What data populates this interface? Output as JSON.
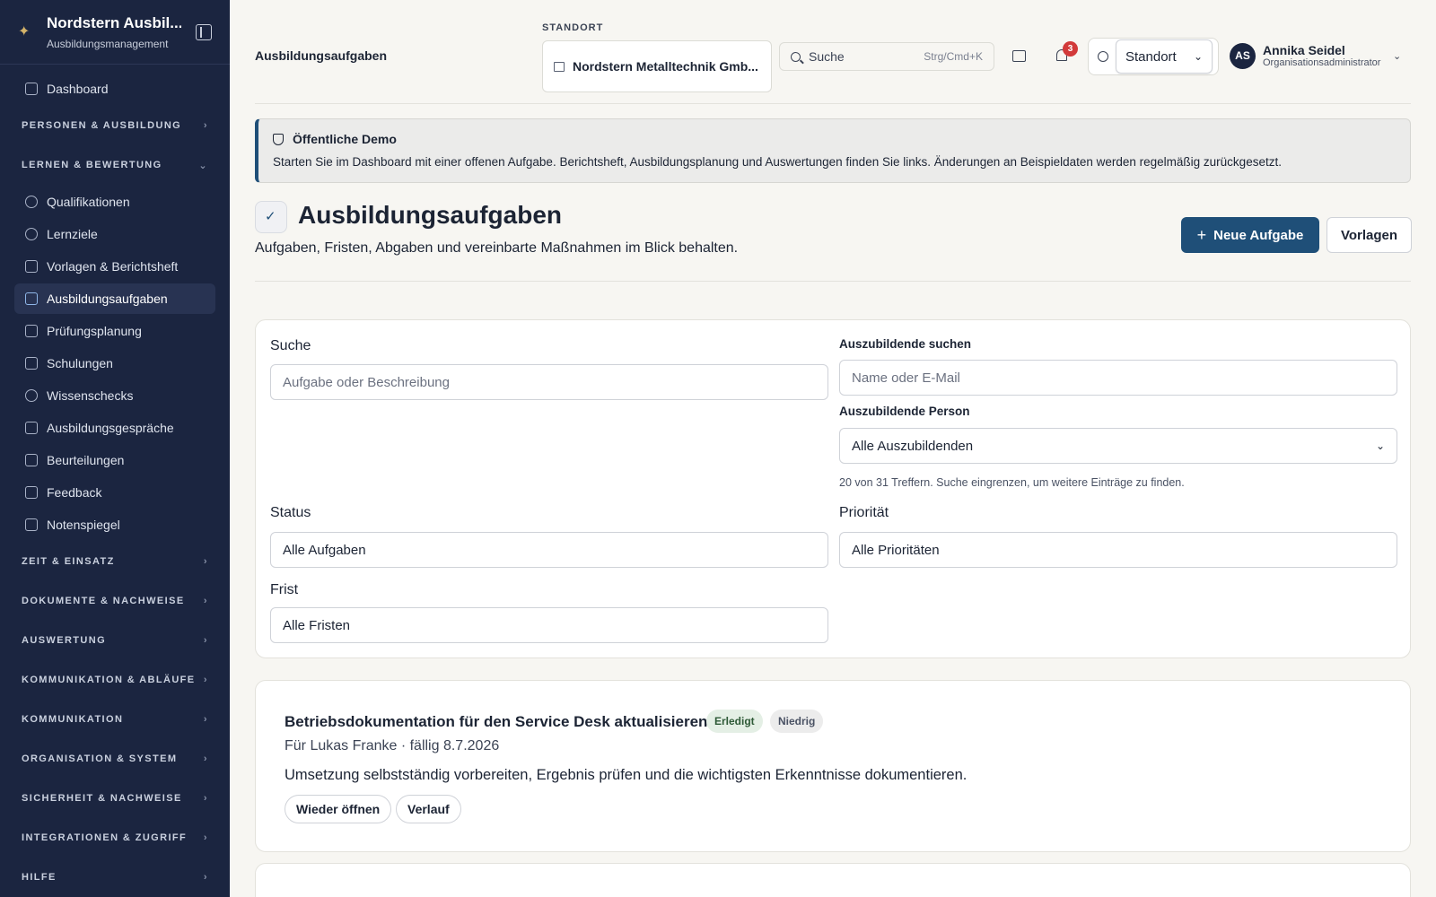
{
  "brand": {
    "title": "Nordstern Ausbil...",
    "subtitle": "Ausbildungsmanagement"
  },
  "sidebar": {
    "top_item": "Dashboard",
    "groups_before": [
      {
        "label": "PERSONEN & AUSBILDUNG"
      },
      {
        "label": "LERNEN & BEWERTUNG"
      }
    ],
    "items": [
      {
        "label": "Qualifikationen",
        "icon": "award-icon"
      },
      {
        "label": "Lernziele",
        "icon": "target-icon"
      },
      {
        "label": "Vorlagen & Berichtsheft",
        "icon": "file-icon"
      },
      {
        "label": "Ausbildungsaufgaben",
        "icon": "checkbox-icon",
        "active": true
      },
      {
        "label": "Prüfungsplanung",
        "icon": "calendar-icon"
      },
      {
        "label": "Schulungen",
        "icon": "book-icon"
      },
      {
        "label": "Wissenschecks",
        "icon": "brain-icon"
      },
      {
        "label": "Ausbildungsgespräche",
        "icon": "message-icon"
      },
      {
        "label": "Beurteilungen",
        "icon": "bar-chart-icon"
      },
      {
        "label": "Feedback",
        "icon": "chat-icon"
      },
      {
        "label": "Notenspiegel",
        "icon": "file-icon"
      }
    ],
    "groups_after": [
      "ZEIT & EINSATZ",
      "DOKUMENTE & NACHWEISE",
      "AUSWERTUNG",
      "KOMMUNIKATION & ABLÄUFE",
      "KOMMUNIKATION",
      "ORGANISATION & SYSTEM",
      "SICHERHEIT & NACHWEISE",
      "INTEGRATIONEN & ZUGRIFF",
      "HILFE"
    ]
  },
  "topbar": {
    "breadcrumb": "Ausbildungsaufgaben",
    "location_label": "STANDORT",
    "location_value": "Nordstern Metalltechnik Gmb...",
    "search_placeholder": "Suche",
    "search_shortcut": "Strg/Cmd+K",
    "notification_count": "3",
    "site_select": "Standort",
    "user_initials": "AS",
    "user_name": "Annika Seidel",
    "user_role": "Organisationsadministrator"
  },
  "demo": {
    "title": "Öffentliche Demo",
    "text": "Starten Sie im Dashboard mit einer offenen Aufgabe. Berichtsheft, Ausbildungsplanung und Auswertungen finden Sie links. Änderungen an Beispieldaten werden regelmäßig zurückgesetzt."
  },
  "page": {
    "title": "Ausbildungsaufgaben",
    "description": "Aufgaben, Fristen, Abgaben und vereinbarte Maßnahmen im Blick behalten.",
    "new_button": "Neue Aufgabe",
    "templates_button": "Vorlagen"
  },
  "filters": {
    "search_label": "Suche",
    "search_placeholder": "Aufgabe oder Beschreibung",
    "trainee_search_label": "Auszubildende suchen",
    "trainee_search_placeholder": "Name oder E-Mail",
    "trainee_label": "Auszubildende Person",
    "trainee_value": "Alle Auszubildenden",
    "hint": "20 von 31 Treffern. Suche eingrenzen, um weitere Einträge zu finden.",
    "status_label": "Status",
    "status_value": "Alle Aufgaben",
    "priority_label": "Priorität",
    "priority_value": "Alle Prioritäten",
    "deadline_label": "Frist",
    "deadline_value": "Alle Fristen"
  },
  "task": {
    "title": "Betriebsdokumentation für den Service Desk aktualisieren",
    "status": "Erledigt",
    "priority": "Niedrig",
    "meta": "Für Lukas Franke · fällig 8.7.2026",
    "description": "Umsetzung selbstständig vorbereiten, Ergebnis prüfen und die wichtigsten Erkenntnisse dokumentieren.",
    "reopen": "Wieder öffnen",
    "history": "Verlauf"
  },
  "colors": {
    "sidebar": "#1b2540",
    "primary": "#1f4f78",
    "accent": "#d4b36a",
    "badge": "#d23a3a"
  }
}
